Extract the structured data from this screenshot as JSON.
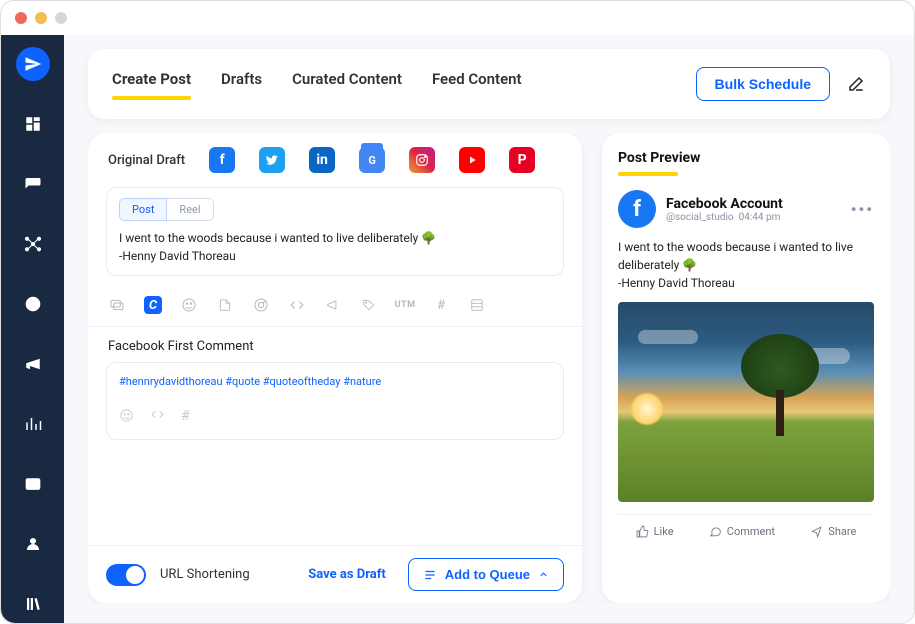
{
  "topnav": {
    "tabs": [
      "Create Post",
      "Drafts",
      "Curated Content",
      "Feed Content"
    ],
    "bulk_label": "Bulk Schedule"
  },
  "editor": {
    "draft_label": "Original Draft",
    "type_tabs": {
      "post": "Post",
      "reel": "Reel"
    },
    "post_text": "I went to the woods because i wanted to live deliberately 🌳\n-Henny David Thoreau",
    "first_comment_label": "Facebook First Comment",
    "first_comment_text": "#hennrydavidthoreau #quote #quoteoftheday #nature",
    "shortening_label": "URL Shortening",
    "save_draft_label": "Save as Draft",
    "queue_label": "Add to Queue",
    "utm_label": "UTM"
  },
  "preview": {
    "title": "Post Preview",
    "account_name": "Facebook Account",
    "handle": "@social_studio",
    "time": "04:44 pm",
    "text": "I went to the woods because i wanted to live deliberately 🌳\n-Henny David Thoreau",
    "actions": {
      "like": "Like",
      "comment": "Comment",
      "share": "Share"
    }
  }
}
